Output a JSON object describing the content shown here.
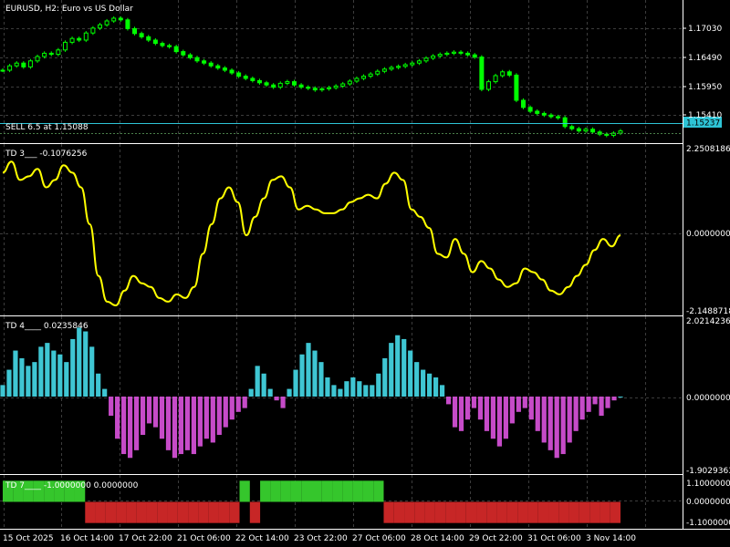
{
  "colors": {
    "background": "#000000",
    "grid": "#3c3c3c",
    "separator": "#ffffff",
    "bull_candle": "#00ff00",
    "bear_candle": "#00ff00",
    "order_line": "#2ec4d6",
    "price_tag_bg": "#2ec4d6",
    "td3_line": "#ffff00",
    "td4_pos": "#3fc6d3",
    "td4_neg": "#c64bc8",
    "td7_green": "#35c62c",
    "td7_red": "#c72626"
  },
  "main": {
    "title": "EURUSD, H2:  Euro vs US Dollar",
    "order_label": "SELL 6.5 at 1.15088",
    "current_price_tag": "1.15237",
    "price_axis": [
      "1.17030",
      "1.16490",
      "1.15950",
      "1.15410"
    ]
  },
  "td3": {
    "label": "TD 3___  -0.1076256",
    "axis": [
      "2.2508186",
      "0.0000000",
      "-2.1488718"
    ]
  },
  "td4": {
    "label": "TD 4____  0.0235846",
    "axis": [
      "2.0214236",
      "0.0000000",
      "-1.9029363"
    ]
  },
  "td7": {
    "label": "TD 7____  -1.0000000 0.0000000",
    "axis": [
      "1.1000000",
      "0.0000000",
      "-1.1000000"
    ]
  },
  "time_axis": [
    "15 Oct 2025",
    "16 Oct 14:00",
    "17 Oct 22:00",
    "21 Oct 06:00",
    "22 Oct 14:00",
    "23 Oct 22:00",
    "27 Oct 06:00",
    "28 Oct 14:00",
    "29 Oct 22:00",
    "31 Oct 06:00",
    "3 Nov 14:00"
  ],
  "chart_data": [
    {
      "type": "line",
      "title": "EURUSD, H2:  Euro vs US Dollar",
      "ylim": [
        1.151,
        1.175
      ],
      "series": [
        {
          "name": "EURUSD close",
          "values": [
            1.1635,
            1.1643,
            1.1648,
            1.1641,
            1.1652,
            1.166,
            1.1666,
            1.1664,
            1.1672,
            1.1686,
            1.1693,
            1.169,
            1.1703,
            1.1712,
            1.1718,
            1.1725,
            1.173,
            1.1727,
            1.1711,
            1.1702,
            1.1696,
            1.169,
            1.1684,
            1.168,
            1.1678,
            1.1669,
            1.1663,
            1.1658,
            1.1652,
            1.1648,
            1.1643,
            1.1639,
            1.1635,
            1.163,
            1.1624,
            1.162,
            1.1616,
            1.1612,
            1.1608,
            1.1604,
            1.1611,
            1.1614,
            1.1608,
            1.1604,
            1.1602,
            1.1599,
            1.1601,
            1.1603,
            1.1606,
            1.161,
            1.1615,
            1.162,
            1.1624,
            1.1628,
            1.1633,
            1.1637,
            1.164,
            1.1642,
            1.1645,
            1.1648,
            1.1652,
            1.1657,
            1.1661,
            1.1664,
            1.1666,
            1.1668,
            1.1666,
            1.1663,
            1.1659,
            1.16,
            1.1614,
            1.1625,
            1.1632,
            1.1626,
            1.158,
            1.1567,
            1.156,
            1.1556,
            1.1553,
            1.155,
            1.1548,
            1.1532,
            1.1528,
            1.1524,
            1.1527,
            1.1522,
            1.1518,
            1.1516,
            1.152,
            1.1524
          ]
        }
      ]
    },
    {
      "type": "line",
      "title": "TD 3___  -0.1076256",
      "ylim": [
        -2.1488718,
        2.2508186
      ],
      "series": [
        {
          "name": "TD 3",
          "values": [
            1.6,
            1.9,
            1.4,
            1.5,
            1.7,
            1.2,
            1.4,
            1.8,
            1.6,
            1.2,
            0.2,
            -1.2,
            -1.9,
            -2.0,
            -1.6,
            -1.2,
            -1.4,
            -1.5,
            -1.8,
            -1.9,
            -1.7,
            -1.8,
            -1.5,
            -0.6,
            0.2,
            0.9,
            1.2,
            0.8,
            -0.1,
            0.4,
            0.9,
            1.4,
            1.5,
            1.2,
            0.6,
            0.7,
            0.6,
            0.5,
            0.5,
            0.6,
            0.8,
            0.9,
            1.0,
            0.9,
            1.3,
            1.6,
            1.4,
            0.6,
            0.4,
            0.1,
            -0.6,
            -0.7,
            -0.2,
            -0.6,
            -1.1,
            -0.8,
            -1.0,
            -1.3,
            -1.5,
            -1.4,
            -1.0,
            -1.1,
            -1.3,
            -1.6,
            -1.7,
            -1.5,
            -1.2,
            -0.9,
            -0.5,
            -0.2,
            -0.4,
            -0.1
          ]
        }
      ]
    },
    {
      "type": "bar",
      "title": "TD 4____  0.0235846",
      "ylim": [
        -1.9029363,
        2.0214236
      ],
      "series": [
        {
          "name": "TD 4",
          "values": [
            0.3,
            0.7,
            1.2,
            1.0,
            0.8,
            0.9,
            1.3,
            1.4,
            1.2,
            1.1,
            0.9,
            1.5,
            1.8,
            1.7,
            1.3,
            0.6,
            0.2,
            -0.5,
            -1.1,
            -1.5,
            -1.6,
            -1.4,
            -1.0,
            -0.7,
            -0.8,
            -1.1,
            -1.4,
            -1.6,
            -1.5,
            -1.4,
            -1.5,
            -1.3,
            -1.1,
            -1.2,
            -1.0,
            -0.8,
            -0.6,
            -0.4,
            -0.3,
            0.2,
            0.8,
            0.6,
            0.2,
            -0.1,
            -0.3,
            0.2,
            0.7,
            1.1,
            1.4,
            1.2,
            0.9,
            0.5,
            0.3,
            0.2,
            0.4,
            0.5,
            0.4,
            0.3,
            0.3,
            0.6,
            1.0,
            1.4,
            1.6,
            1.5,
            1.2,
            0.9,
            0.7,
            0.6,
            0.5,
            0.3,
            -0.2,
            -0.8,
            -0.9,
            -0.6,
            -0.3,
            -0.6,
            -0.9,
            -1.1,
            -1.3,
            -1.1,
            -0.7,
            -0.4,
            -0.3,
            -0.6,
            -0.9,
            -1.2,
            -1.4,
            -1.6,
            -1.5,
            -1.2,
            -0.9,
            -0.6,
            -0.4,
            -0.2,
            -0.5,
            -0.3,
            -0.1,
            0.0
          ]
        }
      ]
    },
    {
      "type": "bar",
      "title": "TD 7____  -1.0000000 0.0000000",
      "ylim": [
        -1.1,
        1.1
      ],
      "series": [
        {
          "name": "TD 7",
          "values": [
            1,
            1,
            1,
            1,
            1,
            1,
            1,
            1,
            -1,
            -1,
            -1,
            -1,
            -1,
            -1,
            -1,
            -1,
            -1,
            -1,
            -1,
            -1,
            -1,
            -1,
            -1,
            1,
            -1,
            1,
            1,
            1,
            1,
            1,
            1,
            1,
            1,
            1,
            1,
            1,
            1,
            -1,
            -1,
            -1,
            -1,
            -1,
            -1,
            -1,
            -1,
            -1,
            -1,
            -1,
            -1,
            -1,
            -1,
            -1,
            -1,
            -1,
            -1,
            -1,
            -1,
            -1,
            -1,
            -1
          ]
        }
      ]
    }
  ]
}
